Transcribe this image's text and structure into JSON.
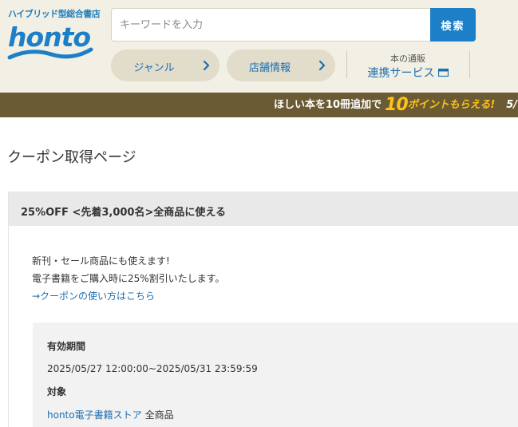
{
  "header": {
    "tagline": "ハイブリッド型総合書店",
    "logo_text": "honto",
    "search": {
      "placeholder": "キーワードを入力",
      "value": "",
      "button_label": "検索"
    },
    "nav": {
      "genre_label": "ジャンル",
      "store_label": "店舗情報",
      "service_top": "本の通販",
      "service_bottom": "連携サービス"
    }
  },
  "promo": {
    "prefix": "ほしい本を10冊追加で",
    "big_number": "10",
    "highlight": "ポイントもらえる!",
    "date_partial": "5/"
  },
  "page": {
    "title": "クーポン取得ページ"
  },
  "coupon": {
    "title": "25%OFF <先着3,000名>全商品に使える",
    "desc_line1": "新刊・セール商品にも使えます!",
    "desc_line2": "電子書籍をご購入時に25%割引いたします。",
    "howto_link": "→クーポンの使い方はこちら",
    "period_label": "有効期間",
    "period_value": "2025/05/27 12:00:00~2025/05/31 23:59:59",
    "target_label": "対象",
    "target_link": "honto電子書籍ストア",
    "target_rest": "全商品"
  },
  "colors": {
    "accent_blue": "#1c7fc7",
    "header_bg": "#f2efe4",
    "promo_bg": "#6b5b34",
    "promo_highlight": "#ffc21a"
  }
}
